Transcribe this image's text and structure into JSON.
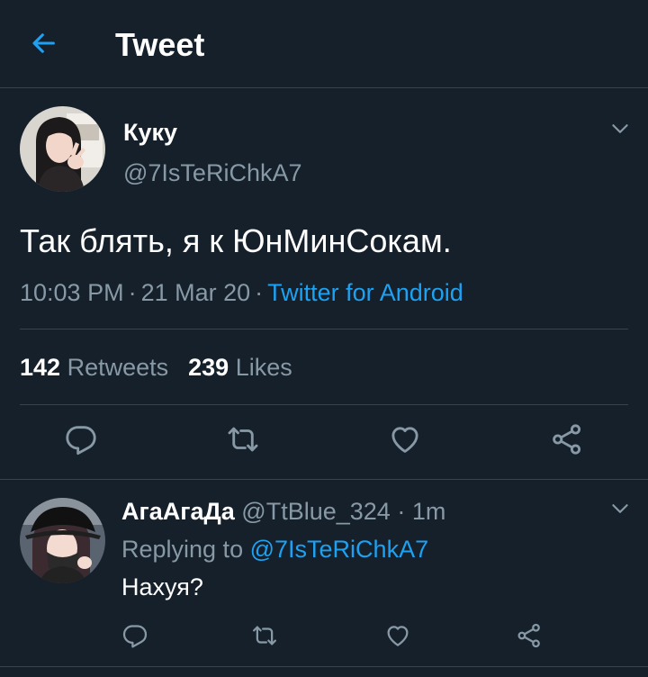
{
  "header": {
    "title": "Tweet",
    "back_icon": "arrow-left-icon"
  },
  "colors": {
    "background": "#15202b",
    "accent": "#1da1f2",
    "muted": "#8899a6",
    "divider": "#38444d"
  },
  "tweet": {
    "display_name": "Куку",
    "handle": "@7IsTeRiChkA7",
    "text": "Так блять, я к ЮнМинСокам.",
    "time": "10:03 PM",
    "separator": "·",
    "date": "21 Mar 20",
    "source": "Twitter for Android",
    "retweets": "142",
    "retweets_label": "Retweets",
    "likes": "239",
    "likes_label": "Likes",
    "caret_icon": "chevron-down-icon",
    "actions": [
      "reply-icon",
      "retweet-icon",
      "like-icon",
      "share-icon"
    ]
  },
  "reply": {
    "display_name": "АгаАгаДа",
    "handle": "@TtBlue_324",
    "separator": "·",
    "time": "1m",
    "replying_to_label": "Replying to",
    "replying_to_handle": "@7IsTeRiChkA7",
    "text": "Нахуя?",
    "caret_icon": "chevron-down-icon",
    "actions": [
      "reply-icon",
      "retweet-icon",
      "like-icon",
      "share-icon"
    ]
  }
}
